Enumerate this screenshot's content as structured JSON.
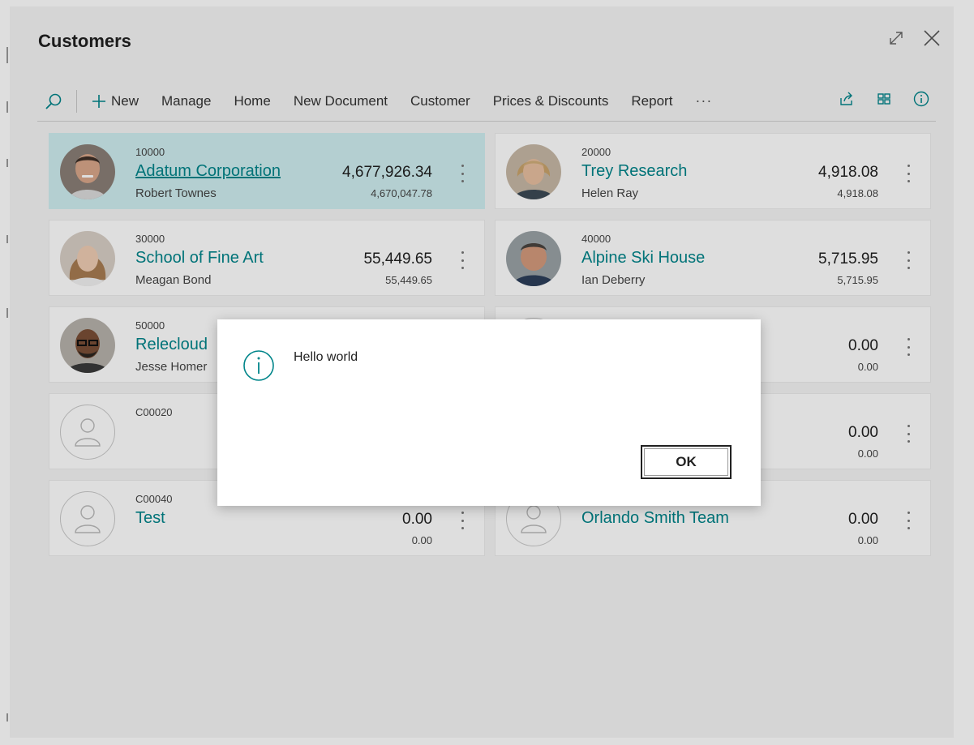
{
  "page": {
    "title": "Customers"
  },
  "actionbar": {
    "new_label": "New",
    "items": [
      "Manage",
      "Home",
      "New Document",
      "Customer",
      "Prices & Discounts",
      "Report"
    ],
    "more_label": "···"
  },
  "customers": [
    {
      "no": "10000",
      "name": "Adatum Corporation",
      "contact": "Robert Townes",
      "balance": "4,677,926.34",
      "balance_due": "4,670,047.78"
    },
    {
      "no": "20000",
      "name": "Trey Research",
      "contact": "Helen Ray",
      "balance": "4,918.08",
      "balance_due": "4,918.08"
    },
    {
      "no": "30000",
      "name": "School of Fine Art",
      "contact": "Meagan Bond",
      "balance": "55,449.65",
      "balance_due": "55,449.65"
    },
    {
      "no": "40000",
      "name": "Alpine Ski House",
      "contact": "Ian Deberry",
      "balance": "5,715.95",
      "balance_due": "5,715.95"
    },
    {
      "no": "50000",
      "name": "Relecloud",
      "contact": "Jesse Homer",
      "balance": "",
      "balance_due": ""
    },
    {
      "no": "",
      "name": "",
      "contact": "",
      "balance": "0.00",
      "balance_due": "0.00"
    },
    {
      "no": "C00020",
      "name": "",
      "contact": "",
      "balance": "",
      "balance_due": ""
    },
    {
      "no": "",
      "name": "",
      "contact": "",
      "balance": "0.00",
      "balance_due": "0.00"
    },
    {
      "no": "C00040",
      "name": "Test",
      "contact": "",
      "balance": "0.00",
      "balance_due": "0.00"
    },
    {
      "no": "",
      "name": "Orlando Smith Team",
      "contact": "",
      "balance": "0.00",
      "balance_due": "0.00"
    }
  ],
  "dialog": {
    "message": "Hello world",
    "ok_label": "OK"
  },
  "colors": {
    "accent": "#00858a",
    "selected_card": "#cfeef0"
  }
}
